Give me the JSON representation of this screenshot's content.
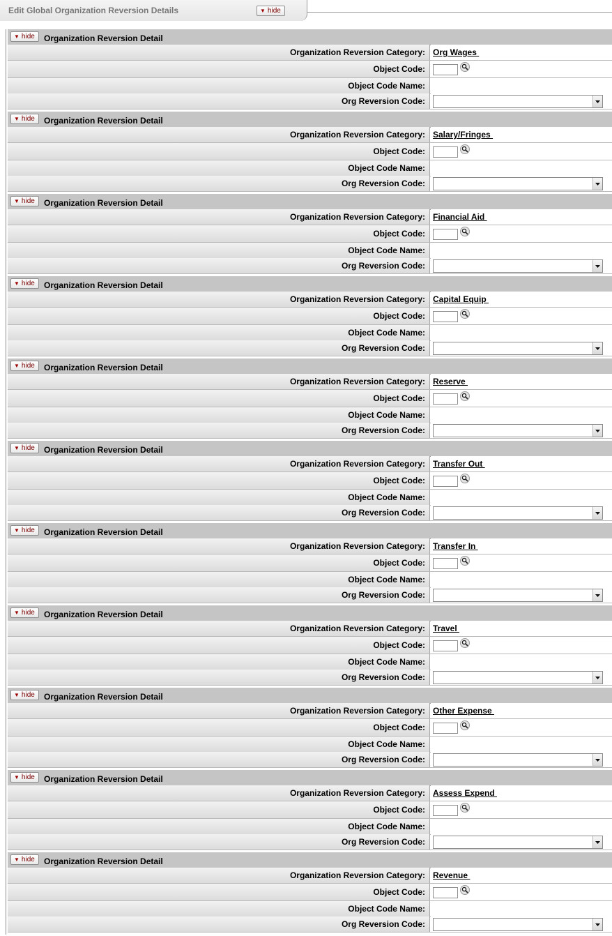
{
  "tab": {
    "title": "Edit Global Organization Reversion Details",
    "hide_label": "hide"
  },
  "labels": {
    "section_title": "Organization Reversion Detail",
    "hide": "hide",
    "category": "Organization Reversion Category:",
    "object_code": "Object Code:",
    "object_code_name": "Object Code Name:",
    "org_reversion_code": "Org Reversion Code:"
  },
  "sections": [
    {
      "category": "Org Wages ",
      "object_code": "",
      "object_code_name": "",
      "org_reversion_code": ""
    },
    {
      "category": "Salary/Fringes ",
      "object_code": "",
      "object_code_name": "",
      "org_reversion_code": ""
    },
    {
      "category": "Financial Aid ",
      "object_code": "",
      "object_code_name": "",
      "org_reversion_code": ""
    },
    {
      "category": "Capital Equip ",
      "object_code": "",
      "object_code_name": "",
      "org_reversion_code": ""
    },
    {
      "category": "Reserve ",
      "object_code": "",
      "object_code_name": "",
      "org_reversion_code": ""
    },
    {
      "category": "Transfer Out ",
      "object_code": "",
      "object_code_name": "",
      "org_reversion_code": ""
    },
    {
      "category": "Transfer In ",
      "object_code": "",
      "object_code_name": "",
      "org_reversion_code": ""
    },
    {
      "category": "Travel ",
      "object_code": "",
      "object_code_name": "",
      "org_reversion_code": ""
    },
    {
      "category": "Other Expense ",
      "object_code": "",
      "object_code_name": "",
      "org_reversion_code": ""
    },
    {
      "category": "Assess Expend ",
      "object_code": "",
      "object_code_name": "",
      "org_reversion_code": ""
    },
    {
      "category": "Revenue ",
      "object_code": "",
      "object_code_name": "",
      "org_reversion_code": ""
    }
  ],
  "icons": {
    "hide": "triangle-down-icon",
    "lookup": "magnifier-icon",
    "dropdown": "chevron-down-icon"
  },
  "colors": {
    "section_header": "#c5c5c5",
    "hide_text": "#7a0000"
  }
}
